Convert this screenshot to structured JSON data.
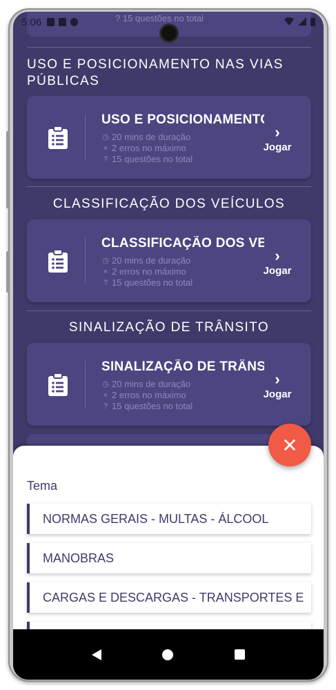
{
  "status_bar": {
    "time": "5:06"
  },
  "top_partial": {
    "questions": "15 questões no total"
  },
  "sections": [
    {
      "heading": "USO E POSICIONAMENTO NAS VIAS PÚBLICAS",
      "card": {
        "title": "USO E POSICIONAMENTO",
        "duration": "20 mins de duração",
        "errors": "2 erros no máximo",
        "questions": "15 questões no total",
        "play_label": "Jogar"
      }
    },
    {
      "heading": "CLASSIFICAÇÃO DOS VEÍCULOS",
      "card": {
        "title": "CLASSIFICAÇÃO DOS VEÍCULOS",
        "duration": "20 mins de duração",
        "errors": "2 erros no máximo",
        "questions": "15 questões no total",
        "play_label": "Jogar"
      }
    },
    {
      "heading": "SINALIZAÇÃO DE TRÂNSITO",
      "card": {
        "title": "SINALIZAÇÃO DE TRÂNSITO",
        "duration": "20 mins de duração",
        "errors": "2 erros no máximo",
        "questions": "15 questões no total",
        "play_label": "Jogar"
      }
    }
  ],
  "sheet": {
    "label": "Tema",
    "options": [
      "NORMAS GERAIS - MULTAS - ÁLCOOL",
      "MANOBRAS",
      "CARGAS E DESCARGAS - TRANSPORTES E"
    ]
  },
  "fab": {
    "icon": "close-icon",
    "color": "#f15a45"
  },
  "colors": {
    "background": "#3f3a69",
    "card": "#4b4680",
    "accent": "#f15a45"
  },
  "icons": {
    "card": "clipboard-list-icon",
    "duration": "clock-icon",
    "errors": "x-icon",
    "questions": "question-circle-icon",
    "play": "chevron-right-icon"
  }
}
